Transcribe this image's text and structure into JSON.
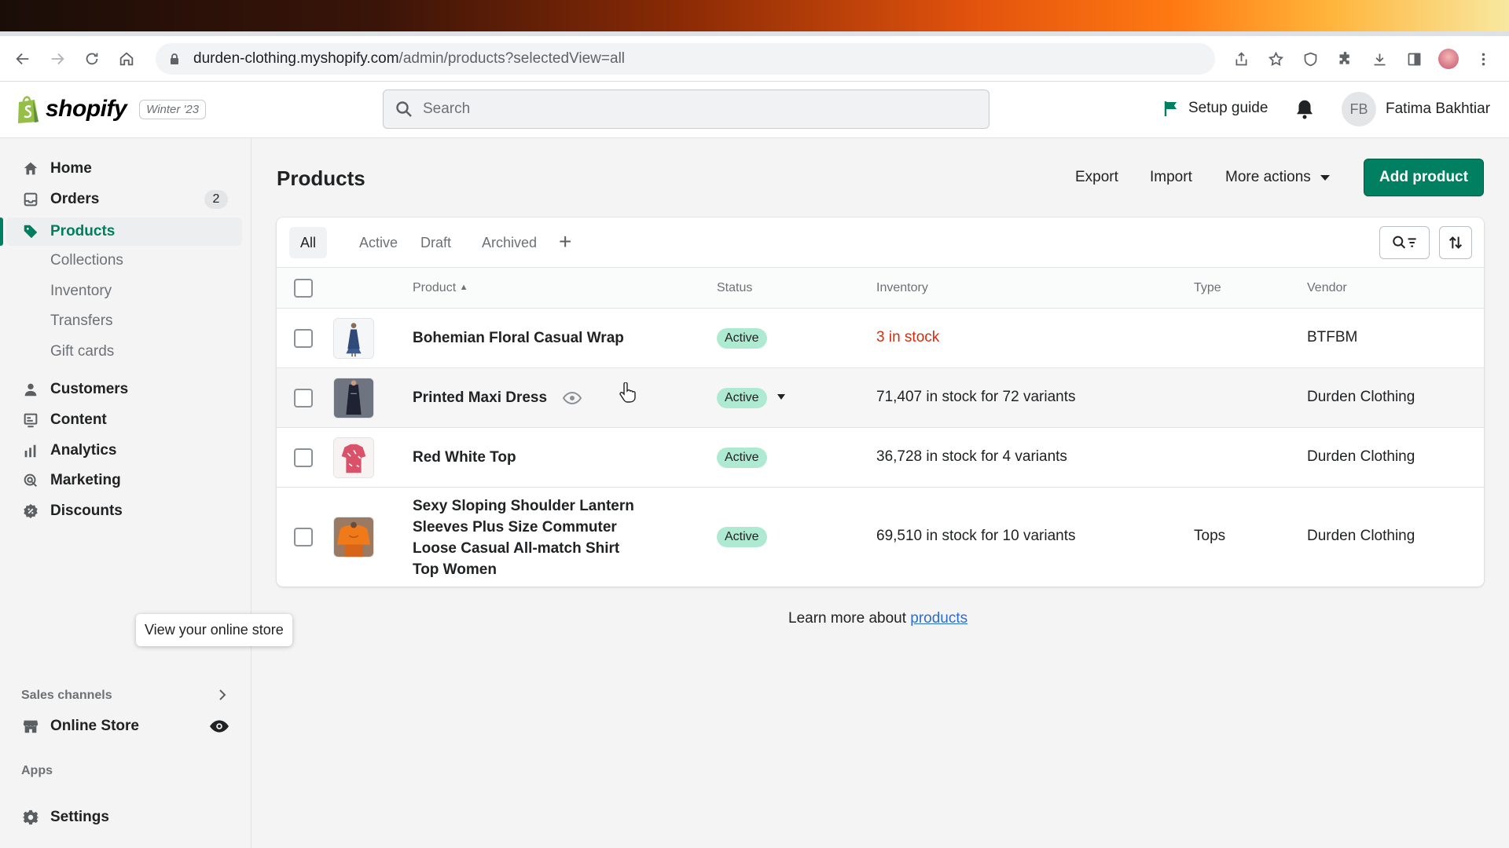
{
  "browser": {
    "url_host": "durden-clothing.myshopify.com",
    "url_path": "/admin/products?selectedView=all"
  },
  "topbar": {
    "logo_text": "shopify",
    "edition": "Winter '23",
    "search_placeholder": "Search",
    "setup_guide": "Setup guide",
    "user_initials": "FB",
    "user_name": "Fatima Bakhtiar"
  },
  "sidebar": {
    "items": [
      {
        "label": "Home",
        "icon": "home-icon"
      },
      {
        "label": "Orders",
        "icon": "orders-icon",
        "badge": "2"
      },
      {
        "label": "Products",
        "icon": "tag-icon",
        "active": true
      },
      {
        "label": "Customers",
        "icon": "person-icon"
      },
      {
        "label": "Content",
        "icon": "content-icon"
      },
      {
        "label": "Analytics",
        "icon": "analytics-icon"
      },
      {
        "label": "Marketing",
        "icon": "marketing-icon"
      },
      {
        "label": "Discounts",
        "icon": "discount-icon"
      }
    ],
    "sub_items": [
      "Collections",
      "Inventory",
      "Transfers",
      "Gift cards"
    ],
    "sales_channels_label": "Sales channels",
    "online_store": "Online Store",
    "apps_label": "Apps",
    "settings": "Settings",
    "tooltip": "View your online store"
  },
  "page": {
    "title": "Products",
    "export": "Export",
    "import": "Import",
    "more_actions": "More actions",
    "add_product": "Add product"
  },
  "tabs": [
    "All",
    "Active",
    "Draft",
    "Archived"
  ],
  "table": {
    "headers": {
      "product": "Product",
      "status": "Status",
      "inventory": "Inventory",
      "type": "Type",
      "vendor": "Vendor"
    },
    "rows": [
      {
        "name": "Bohemian Floral Casual Wrap",
        "status": "Active",
        "inventory": "3 in stock",
        "type": "",
        "vendor": "BTFBM"
      },
      {
        "name": "Printed Maxi Dress",
        "status": "Active",
        "inventory": "71,407 in stock for 72 variants",
        "type": "",
        "vendor": "Durden Clothing"
      },
      {
        "name": "Red White Top",
        "status": "Active",
        "inventory": "36,728 in stock for 4 variants",
        "type": "",
        "vendor": "Durden Clothing"
      },
      {
        "name": "Sexy Sloping Shoulder Lantern Sleeves Plus Size Commuter Loose Casual All-match Shirt Top Women",
        "status": "Active",
        "inventory": "69,510 in stock for 10 variants",
        "type": "Tops",
        "vendor": "Durden Clothing"
      }
    ]
  },
  "footer": {
    "learn_prefix": "Learn more about ",
    "learn_link": "products"
  },
  "colors": {
    "accent": "#008060",
    "status_active_bg": "#aee9d1",
    "low_stock": "#d72c0d",
    "link": "#2c6ecb"
  }
}
